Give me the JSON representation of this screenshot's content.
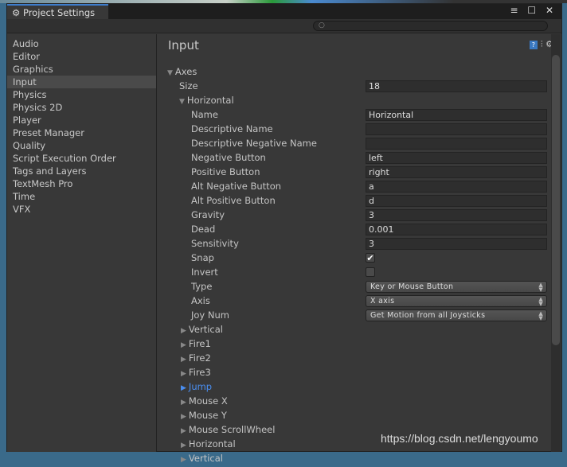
{
  "window": {
    "title": "Project Settings",
    "controls": "≡ ☐ ✕"
  },
  "search": {
    "placeholder": "",
    "icon": "search-icon"
  },
  "sidebar": {
    "items": [
      {
        "label": "Audio"
      },
      {
        "label": "Editor"
      },
      {
        "label": "Graphics"
      },
      {
        "label": "Input",
        "selected": true
      },
      {
        "label": "Physics"
      },
      {
        "label": "Physics 2D"
      },
      {
        "label": "Player"
      },
      {
        "label": "Preset Manager"
      },
      {
        "label": "Quality"
      },
      {
        "label": "Script Execution Order"
      },
      {
        "label": "Tags and Layers"
      },
      {
        "label": "TextMesh Pro"
      },
      {
        "label": "Time"
      },
      {
        "label": "VFX"
      }
    ]
  },
  "main": {
    "title": "Input",
    "axes_label": "Axes",
    "size_label": "Size",
    "size_value": "18",
    "horizontal": {
      "label": "Horizontal",
      "fields": [
        {
          "label": "Name",
          "value": "Horizontal",
          "type": "text"
        },
        {
          "label": "Descriptive Name",
          "value": "",
          "type": "text"
        },
        {
          "label": "Descriptive Negative Name",
          "value": "",
          "type": "text"
        },
        {
          "label": "Negative Button",
          "value": "left",
          "type": "text"
        },
        {
          "label": "Positive Button",
          "value": "right",
          "type": "text"
        },
        {
          "label": "Alt Negative Button",
          "value": "a",
          "type": "text"
        },
        {
          "label": "Alt Positive Button",
          "value": "d",
          "type": "text"
        },
        {
          "label": "Gravity",
          "value": "3",
          "type": "text"
        },
        {
          "label": "Dead",
          "value": "0.001",
          "type": "text"
        },
        {
          "label": "Sensitivity",
          "value": "3",
          "type": "text"
        },
        {
          "label": "Snap",
          "checked": true,
          "type": "check"
        },
        {
          "label": "Invert",
          "checked": false,
          "type": "check"
        },
        {
          "label": "Type",
          "value": "Key or Mouse Button",
          "type": "select"
        },
        {
          "label": "Axis",
          "value": "X axis",
          "type": "select"
        },
        {
          "label": "Joy Num",
          "value": "Get Motion from all Joysticks",
          "type": "select"
        }
      ]
    },
    "collapsed": [
      {
        "label": "Vertical"
      },
      {
        "label": "Fire1"
      },
      {
        "label": "Fire2"
      },
      {
        "label": "Fire3"
      },
      {
        "label": "Jump",
        "highlighted": true
      },
      {
        "label": "Mouse X"
      },
      {
        "label": "Mouse Y"
      },
      {
        "label": "Mouse ScrollWheel"
      },
      {
        "label": "Horizontal"
      },
      {
        "label": "Vertical"
      }
    ]
  },
  "watermark": "https://blog.csdn.net/lengyoumo",
  "colors": {
    "accent": "#3d7dcc",
    "highlight": "#4a8ef0",
    "background": "#383838"
  }
}
